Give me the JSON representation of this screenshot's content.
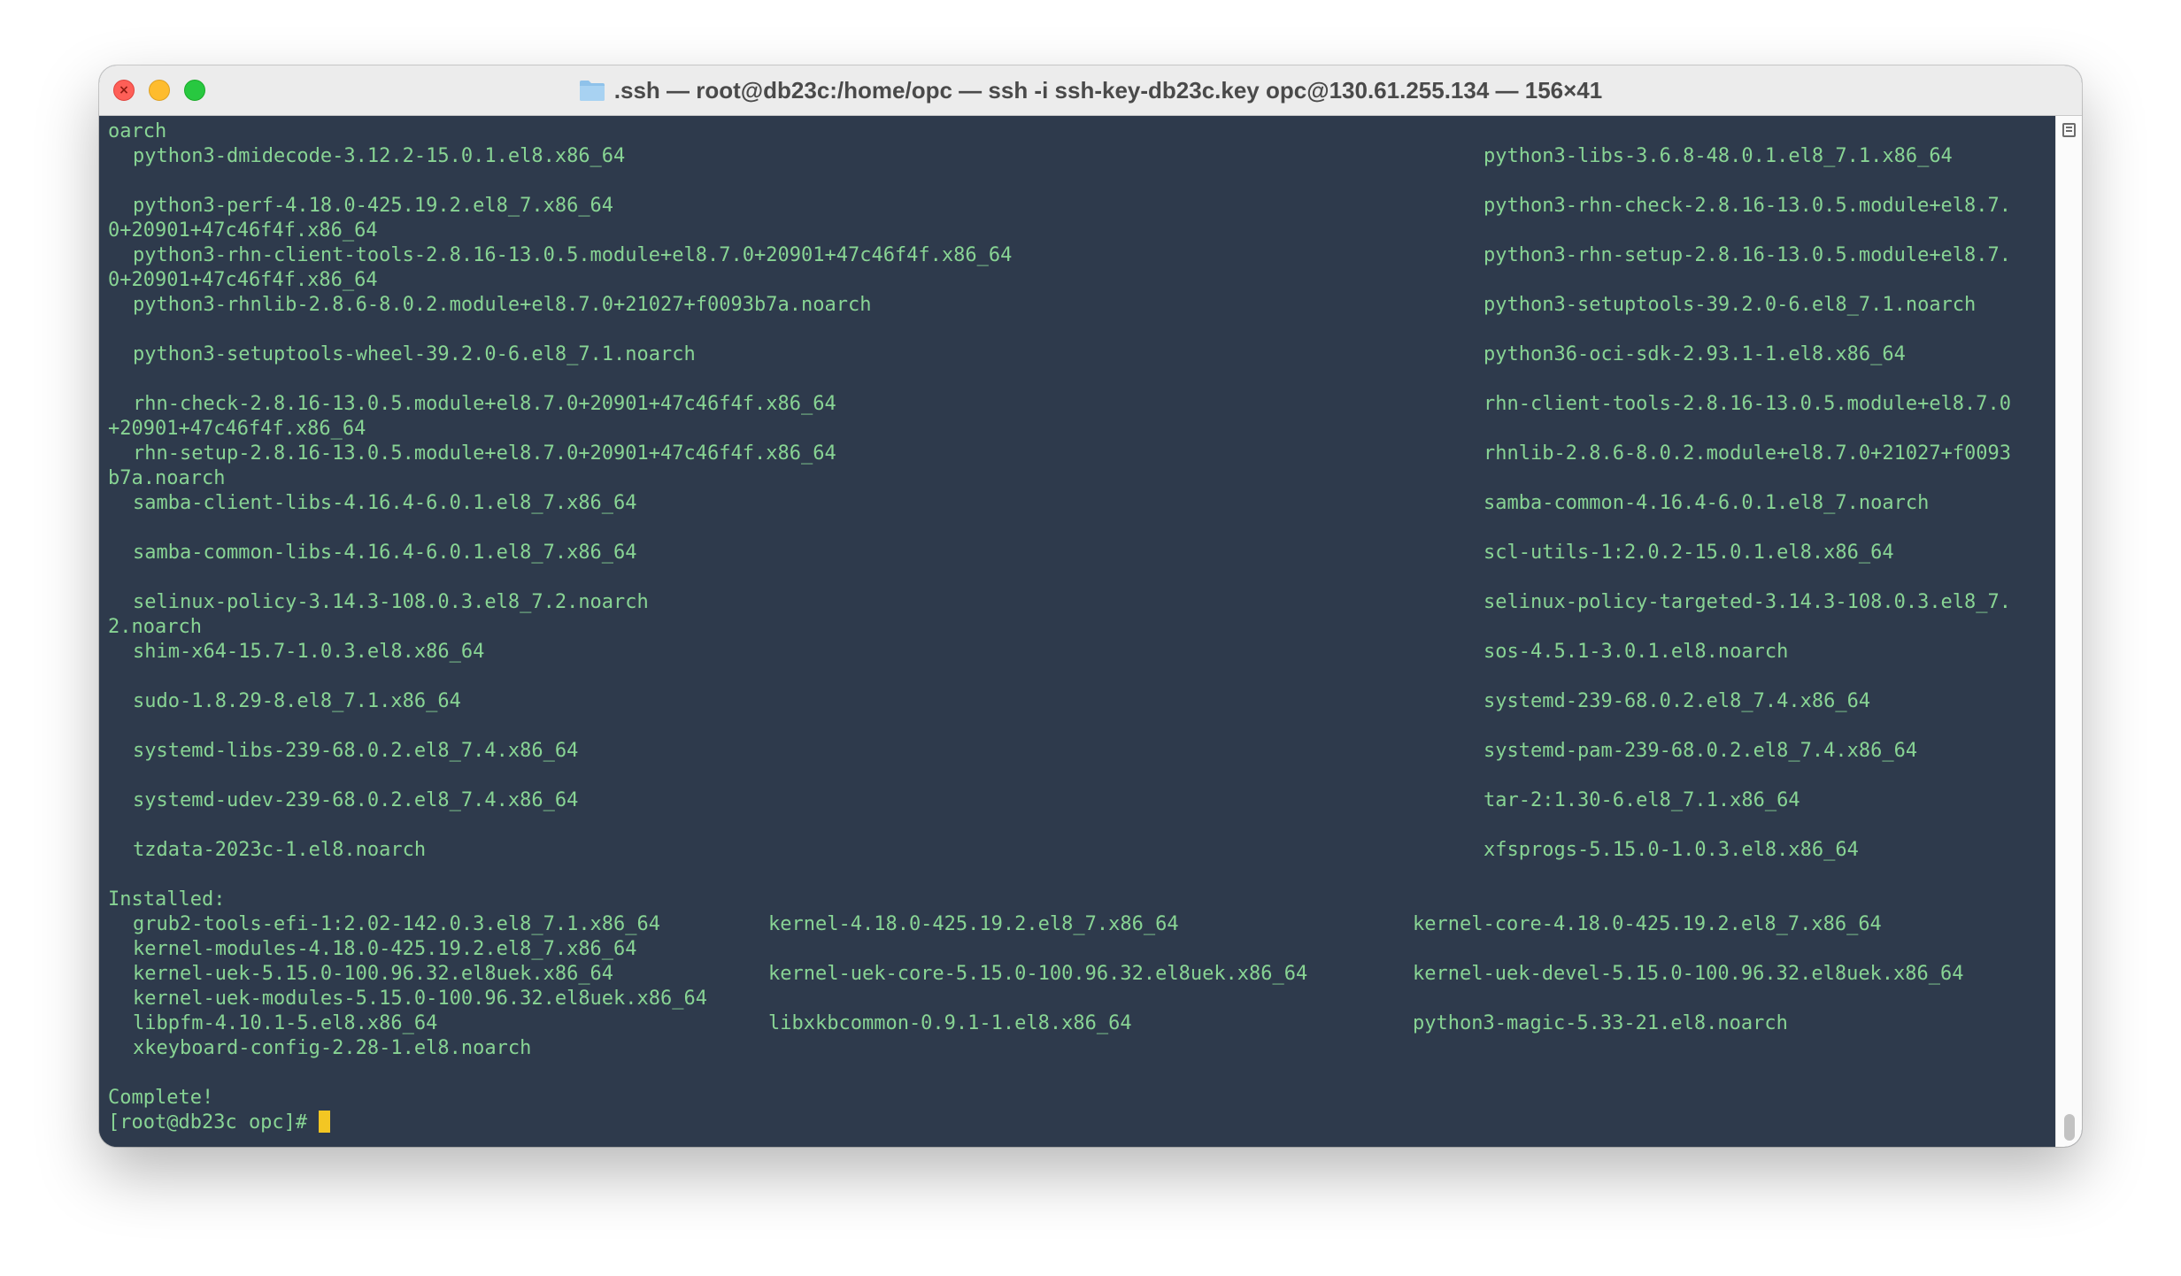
{
  "window": {
    "title": ".ssh — root@db23c:/home/opc — ssh -i ssh-key-db23c.key opc@130.61.255.134 — 156×41",
    "title_icon": "folder-icon"
  },
  "colors": {
    "terminal_background": "#2e3a4c",
    "terminal_text": "#88d494",
    "cursor": "#f3c623"
  },
  "terminal": {
    "lines": [
      {
        "c0": "oarch"
      },
      {
        "c1": "python3-dmidecode-3.12.2-15.0.1.el8.x86_64",
        "c4": "python3-libs-3.6.8-48.0.1.el8_7.1.x86_64"
      },
      {},
      {
        "c1": "python3-perf-4.18.0-425.19.2.el8_7.x86_64",
        "c4": "python3-rhn-check-2.8.16-13.0.5.module+el8.7."
      },
      {
        "c0": "0+20901+47c46f4f.x86_64"
      },
      {
        "c1": "python3-rhn-client-tools-2.8.16-13.0.5.module+el8.7.0+20901+47c46f4f.x86_64",
        "c4": "python3-rhn-setup-2.8.16-13.0.5.module+el8.7."
      },
      {
        "c0": "0+20901+47c46f4f.x86_64"
      },
      {
        "c1": "python3-rhnlib-2.8.6-8.0.2.module+el8.7.0+21027+f0093b7a.noarch",
        "c4": "python3-setuptools-39.2.0-6.el8_7.1.noarch"
      },
      {},
      {
        "c1": "python3-setuptools-wheel-39.2.0-6.el8_7.1.noarch",
        "c4": "python36-oci-sdk-2.93.1-1.el8.x86_64"
      },
      {},
      {
        "c1": "rhn-check-2.8.16-13.0.5.module+el8.7.0+20901+47c46f4f.x86_64",
        "c4": "rhn-client-tools-2.8.16-13.0.5.module+el8.7.0"
      },
      {
        "c0": "+20901+47c46f4f.x86_64"
      },
      {
        "c1": "rhn-setup-2.8.16-13.0.5.module+el8.7.0+20901+47c46f4f.x86_64",
        "c4": "rhnlib-2.8.6-8.0.2.module+el8.7.0+21027+f0093"
      },
      {
        "c0": "b7a.noarch"
      },
      {
        "c1": "samba-client-libs-4.16.4-6.0.1.el8_7.x86_64",
        "c4": "samba-common-4.16.4-6.0.1.el8_7.noarch"
      },
      {},
      {
        "c1": "samba-common-libs-4.16.4-6.0.1.el8_7.x86_64",
        "c4": "scl-utils-1:2.0.2-15.0.1.el8.x86_64"
      },
      {},
      {
        "c1": "selinux-policy-3.14.3-108.0.3.el8_7.2.noarch",
        "c4": "selinux-policy-targeted-3.14.3-108.0.3.el8_7."
      },
      {
        "c0": "2.noarch"
      },
      {
        "c1": "shim-x64-15.7-1.0.3.el8.x86_64",
        "c4": "sos-4.5.1-3.0.1.el8.noarch"
      },
      {},
      {
        "c1": "sudo-1.8.29-8.el8_7.1.x86_64",
        "c4": "systemd-239-68.0.2.el8_7.4.x86_64"
      },
      {},
      {
        "c1": "systemd-libs-239-68.0.2.el8_7.4.x86_64",
        "c4": "systemd-pam-239-68.0.2.el8_7.4.x86_64"
      },
      {},
      {
        "c1": "systemd-udev-239-68.0.2.el8_7.4.x86_64",
        "c4": "tar-2:1.30-6.el8_7.1.x86_64"
      },
      {},
      {
        "c1": "tzdata-2023c-1.el8.noarch",
        "c4": "xfsprogs-5.15.0-1.0.3.el8.x86_64"
      },
      {},
      {
        "c0": "Installed:"
      },
      {
        "c1": "grub2-tools-efi-1:2.02-142.0.3.el8_7.1.x86_64",
        "c2": "kernel-4.18.0-425.19.2.el8_7.x86_64",
        "c3": "kernel-core-4.18.0-425.19.2.el8_7.x86_64"
      },
      {
        "c1": "kernel-modules-4.18.0-425.19.2.el8_7.x86_64"
      },
      {
        "c1": "kernel-uek-5.15.0-100.96.32.el8uek.x86_64",
        "c2": "kernel-uek-core-5.15.0-100.96.32.el8uek.x86_64",
        "c3": "kernel-uek-devel-5.15.0-100.96.32.el8uek.x86_64"
      },
      {
        "c1": "kernel-uek-modules-5.15.0-100.96.32.el8uek.x86_64"
      },
      {
        "c1": "libpfm-4.10.1-5.el8.x86_64",
        "c2": "libxkbcommon-0.9.1-1.el8.x86_64",
        "c3": "python3-magic-5.33-21.el8.noarch"
      },
      {
        "c1": "xkeyboard-config-2.28-1.el8.noarch"
      },
      {},
      {
        "c0": "Complete!"
      },
      {
        "c0": "[root@db23c opc]# ",
        "cursor": true
      }
    ]
  }
}
